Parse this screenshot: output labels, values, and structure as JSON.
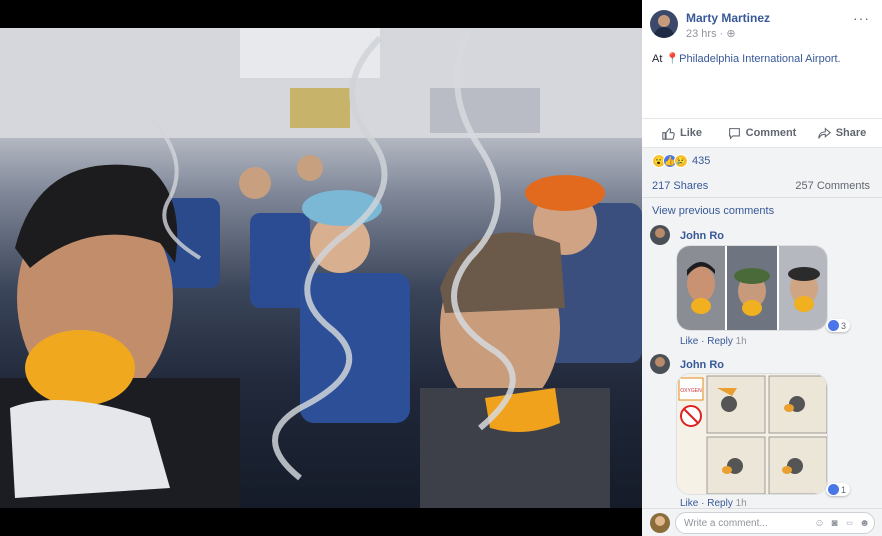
{
  "post": {
    "author": "Marty Martinez",
    "time": "23 hrs",
    "audience_sep": "·",
    "privacy_icon": "globe-icon",
    "more": "···",
    "location_prefix": "At",
    "location": "Philadelphia International Airport."
  },
  "actions": {
    "like": "Like",
    "comment": "Comment",
    "share": "Share"
  },
  "stats": {
    "reaction_count": "435",
    "reaction_icons": [
      "wow-icon",
      "like-icon",
      "sad-icon"
    ],
    "shares": "217 Shares",
    "comments": "257 Comments"
  },
  "comments_section": {
    "view_previous": "View previous comments",
    "items": [
      {
        "author": "John Ro",
        "like": "Like",
        "sep": "·",
        "reply": "Reply",
        "time": "1h",
        "reaction_count": "3",
        "image_type": "photo-collage"
      },
      {
        "author": "John Ro",
        "like": "Like",
        "sep": "·",
        "reply": "Reply",
        "time": "1h",
        "reaction_count": "1",
        "image_type": "safety-card",
        "safety_card_label": "OXYGEN"
      }
    ]
  },
  "composer": {
    "placeholder": "Write a comment...",
    "icons": [
      "emoji-icon",
      "camera-icon",
      "gif-icon",
      "sticker-icon"
    ]
  },
  "colors": {
    "link": "#385898",
    "muted": "#90949c",
    "panel_bg": "#f2f3f5",
    "viewer_bg": "#000000",
    "reaction_like": "#4a76e8"
  }
}
